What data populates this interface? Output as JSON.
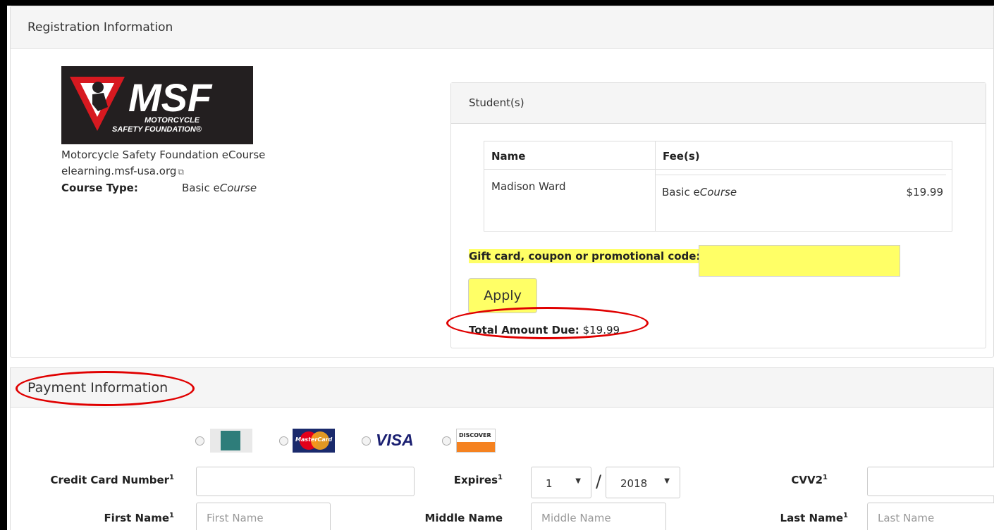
{
  "registration": {
    "title": "Registration Information",
    "logo_text_main": "MSF",
    "logo_text_sub1": "MOTORCYCLE",
    "logo_text_sub2": "SAFETY FOUNDATION®",
    "course_name": "Motorcycle Safety Foundation eCourse",
    "course_url": "elearning.msf-usa.org",
    "course_type_label": "Course Type:",
    "course_type_prefix": "Basic e",
    "course_type_italic": "Course"
  },
  "students": {
    "title": "Student(s)",
    "col_name": "Name",
    "col_fees": "Fee(s)",
    "rows": [
      {
        "name": "Madison Ward",
        "fee_prefix": "Basic e",
        "fee_italic": "Course",
        "amount": "$19.99"
      }
    ],
    "promo_label": "Gift card, coupon or promotional code:",
    "promo_value": "",
    "apply_label": "Apply",
    "total_label": "Total Amount Due:",
    "total_value": "$19.99"
  },
  "payment": {
    "title": "Payment Information",
    "cards": [
      "amex-icon",
      "mastercard-icon",
      "visa-icon",
      "discover-icon"
    ],
    "visa_text": "VISA",
    "discover_text": "DISCOVER",
    "mastercard_text": "MasterCard",
    "credit_card_label": "Credit Card Number",
    "expires_label": "Expires",
    "expires_month": "1",
    "expires_year": "2018",
    "cvv_label": "CVV2",
    "first_name_label": "First Name",
    "first_name_placeholder": "First Name",
    "middle_name_label": "Middle Name",
    "middle_name_placeholder": "Middle Name",
    "last_name_label": "Last Name",
    "last_name_placeholder": "Last Name",
    "required_mark": "1"
  },
  "colors": {
    "highlight": "#ffff66",
    "annotation_red": "#e00000",
    "logo_bg": "#231f20"
  }
}
